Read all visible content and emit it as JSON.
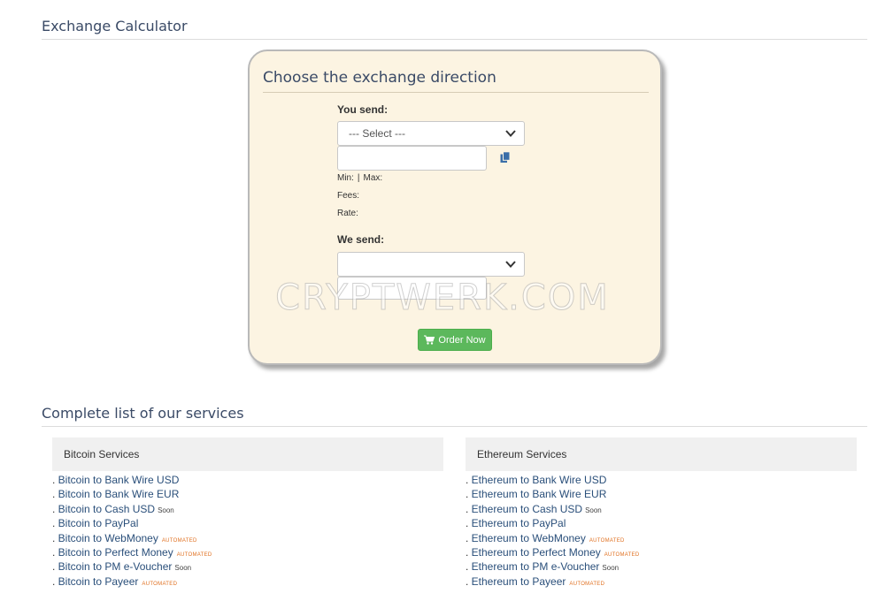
{
  "calculator": {
    "section_title": "Exchange Calculator",
    "panel_title": "Choose the exchange direction",
    "you_send_label": "You send:",
    "send_select_value": "--- Select ---",
    "send_amount": "",
    "min_label": "Min:",
    "max_label": "Max:",
    "separator": "|",
    "fees_label": "Fees:",
    "rate_label": "Rate:",
    "we_send_label": "We send:",
    "receive_select_value": "",
    "receive_amount": "",
    "order_button": "Order Now",
    "order_icon": "shopping-cart-icon",
    "copy_icon": "copy-icon",
    "watermark": "CRYPTWERK.COM",
    "accent_color": "#5cb85c",
    "panel_color": "#fcf4e2"
  },
  "services": {
    "section_title": "Complete list of our services",
    "bitcoin": {
      "header": "Bitcoin Services",
      "items": [
        {
          "label": "Bitcoin to Bank Wire USD",
          "tag": ""
        },
        {
          "label": "Bitcoin to Bank Wire EUR",
          "tag": ""
        },
        {
          "label": "Bitcoin to Cash USD",
          "tag": "Soon"
        },
        {
          "label": "Bitcoin to PayPal",
          "tag": ""
        },
        {
          "label": "Bitcoin to WebMoney",
          "tag": "AUTOMATED"
        },
        {
          "label": "Bitcoin to Perfect Money",
          "tag": "AUTOMATED"
        },
        {
          "label": "Bitcoin to PM e-Voucher",
          "tag": "Soon"
        },
        {
          "label": "Bitcoin to Payeer",
          "tag": "AUTOMATED"
        }
      ]
    },
    "ethereum": {
      "header": "Ethereum Services",
      "items": [
        {
          "label": "Ethereum to Bank Wire USD",
          "tag": ""
        },
        {
          "label": "Ethereum to Bank Wire EUR",
          "tag": ""
        },
        {
          "label": "Ethereum to Cash USD",
          "tag": "Soon"
        },
        {
          "label": "Ethereum to PayPal",
          "tag": ""
        },
        {
          "label": "Ethereum to WebMoney",
          "tag": "AUTOMATED"
        },
        {
          "label": "Ethereum to Perfect Money",
          "tag": "AUTOMATED"
        },
        {
          "label": "Ethereum to PM e-Voucher",
          "tag": "Soon"
        },
        {
          "label": "Ethereum to Payeer",
          "tag": "AUTOMATED"
        }
      ]
    },
    "link_color": "#2a4f7a",
    "automated_color": "#e07020"
  }
}
